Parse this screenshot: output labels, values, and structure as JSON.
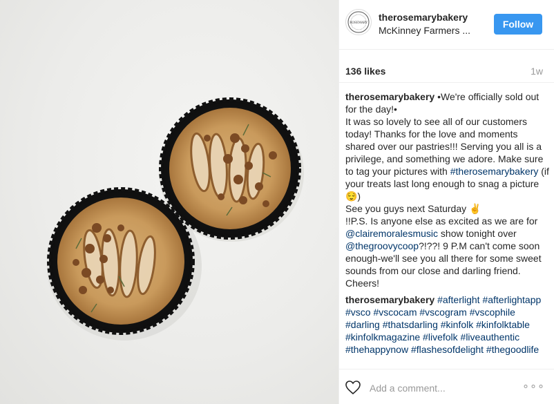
{
  "header": {
    "username": "therosemarybakery",
    "location": "McKinney Farmers ...",
    "follow_label": "Follow",
    "avatar_text": "ROSEMARY"
  },
  "stats": {
    "likes": "136 likes",
    "time": "1w"
  },
  "caption": {
    "username": "therosemarybakery",
    "part1": " •We're officially sold out for the day!•",
    "part2": "It was so lovely to see all of our customers today! Thanks for the love and moments shared over our pastries!!! Serving you all is a privilege, and something we adore. Make sure to tag your pictures with ",
    "tag1": "#therosemarybakery",
    "part3": " (if your treats last long enough to snag a picture 😌)",
    "part4": "See you guys next Saturday ✌",
    "part5": "!!P.S. Is anyone else as excited as we are for ",
    "mention1": "@clairemoralesmusic",
    "part6": " show tonight over ",
    "mention2": "@thegroovycoop",
    "part7": "?!??! 9 P.M can't come soon enough-we'll see you all there for some sweet sounds from our close and darling friend. Cheers!"
  },
  "hashtag_comment": {
    "username": "therosemarybakery",
    "tags": "#afterlight #afterlightapp #vsco #vscocam #vscogram #vscophile #darling #thatsdarling #kinfolk #kinfolktable #kinfolkmagazine #livefolk #liveauthentic #thehappynow #flashesofdelight #thegoodlife"
  },
  "footer": {
    "add_comment_placeholder": "Add a comment...",
    "more_label": "∘∘∘"
  },
  "icons": {
    "like": "heart-icon",
    "more": "more-options-icon"
  },
  "colors": {
    "follow_bg": "#3897f0",
    "hashtag": "#003569",
    "muted": "#999999"
  }
}
